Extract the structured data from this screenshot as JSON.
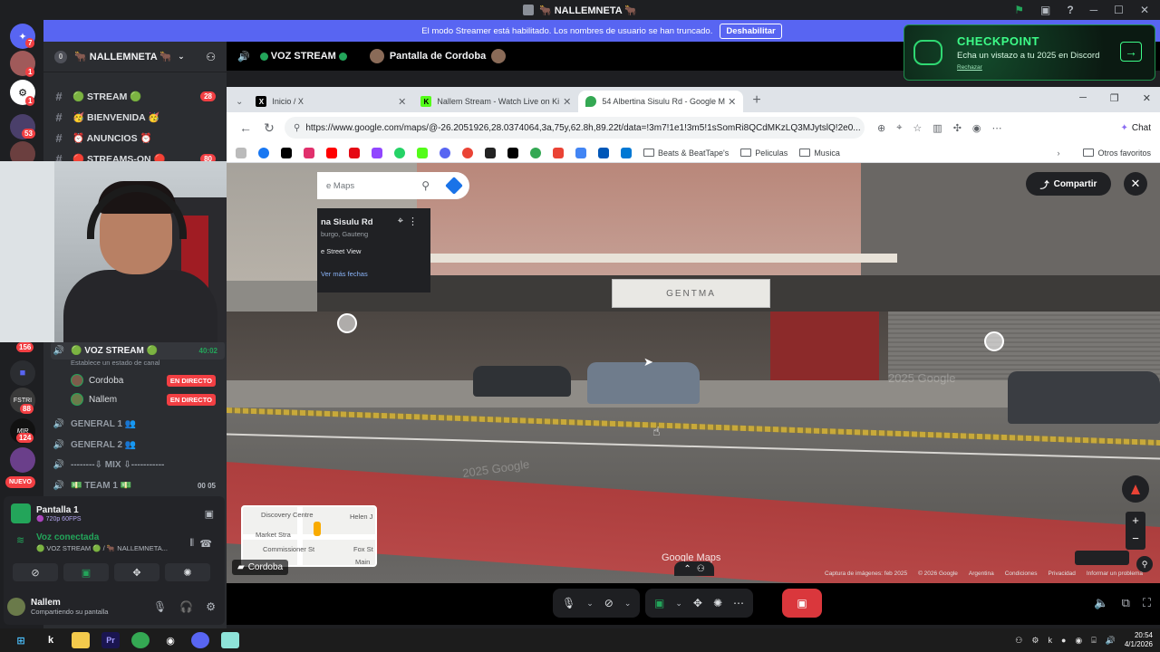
{
  "window": {
    "title": "🐂 NALLEMNETA 🐂"
  },
  "banner": {
    "text": "El modo Streamer está habilitado. Los nombres de usuario se han truncado.",
    "button": "Deshabilitar"
  },
  "rail": {
    "badges": [
      "7",
      "1",
      "1",
      "53",
      "156",
      "88",
      "124"
    ],
    "new_label": "NUEVO",
    "server_small_text": [
      "FSTRI",
      "MIR"
    ]
  },
  "sidebar": {
    "boost_count": "0",
    "server_name": "🐂 NALLEMNETA 🐂",
    "text_channels": [
      {
        "name": "🟢 STREAM 🟢",
        "count": "28"
      },
      {
        "name": "🥳 BIENVENIDA 🥳",
        "count": ""
      },
      {
        "name": "⏰ ANUNCIOS ⏰",
        "count": ""
      },
      {
        "name": "🔴 STREAMS-ON 🔴",
        "count": "80"
      }
    ],
    "voice_channel": {
      "name": "🟢 VOZ STREAM 🟢",
      "timer": "40:02",
      "status": "Establece un estado de canal",
      "users": [
        {
          "name": "Cordoba",
          "live": "EN DIRECTO"
        },
        {
          "name": "Nallem",
          "live": "EN DIRECTO"
        }
      ]
    },
    "other_voice": [
      {
        "name": "GENERAL 1 👥",
        "extra": ""
      },
      {
        "name": "GENERAL 2 👥",
        "extra": ""
      },
      {
        "name": "--------⇩ MIX ⇩-----------",
        "extra": ""
      },
      {
        "name": "💵 TEAM 1 💵",
        "extra": "00 05"
      }
    ]
  },
  "voice_panel": {
    "stream_title": "Pantalla 1",
    "stream_quality": "🟣 720p 60FPS",
    "connected": "Voz conectada",
    "connected_sub": "🟢 VOZ STREAM 🟢 / 🐂 NALLEMNETA...",
    "user_name": "Nallem",
    "user_status": "Compartiendo su pantalla"
  },
  "voice_header": {
    "channel": "VOZ STREAM",
    "screen_label": "Pantalla de Cordoba"
  },
  "checkpoint": {
    "title": "CHECKPOINT",
    "subtitle": "Echa un vistazo a tu 2025 en Discord",
    "dismiss": "Rechazar"
  },
  "browser": {
    "tabs": [
      {
        "label": "Inicio / X",
        "active": false
      },
      {
        "label": "Nallem Stream - Watch Live on Ki",
        "active": false
      },
      {
        "label": "54 Albertina Sisulu Rd - Google M",
        "active": true
      }
    ],
    "url": "https://www.google.com/maps/@-26.2051926,28.0374064,3a,75y,62.8h,89.22t/data=!3m7!1e1!3m5!1sSomRi8QCdMKzLQ3MJytslQ!2e0...",
    "chat_label": "Chat",
    "bookmark_folders": [
      "Beats & BeatTape's",
      "Peliculas",
      "Musica"
    ],
    "other_favorites": "Otros favoritos"
  },
  "streetview": {
    "search_placeholder": "e Maps",
    "place_name": "na Sisulu Rd",
    "place_location": "burgo, Gauteng",
    "street_view_label": "e Street View",
    "more_dates": "Ver más fechas",
    "share_label": "Compartir",
    "google_maps": "Google Maps",
    "minimap_labels": [
      "Discovery Centre",
      "Market Stra",
      "Commissioner St",
      "Helen J",
      "Fox St",
      "Main"
    ],
    "footer": [
      "Captura de imágenes: feb 2025",
      "© 2026 Google",
      "Argentina",
      "Condiciones",
      "Privacidad",
      "Informar un problema"
    ],
    "sign_text": "GENTMA",
    "watermarks": [
      "2025 Google",
      "2025 Google"
    ]
  },
  "stream_owner": "Cordoba",
  "taskbar": {
    "time": "20:54",
    "date": "4/1/2026"
  }
}
